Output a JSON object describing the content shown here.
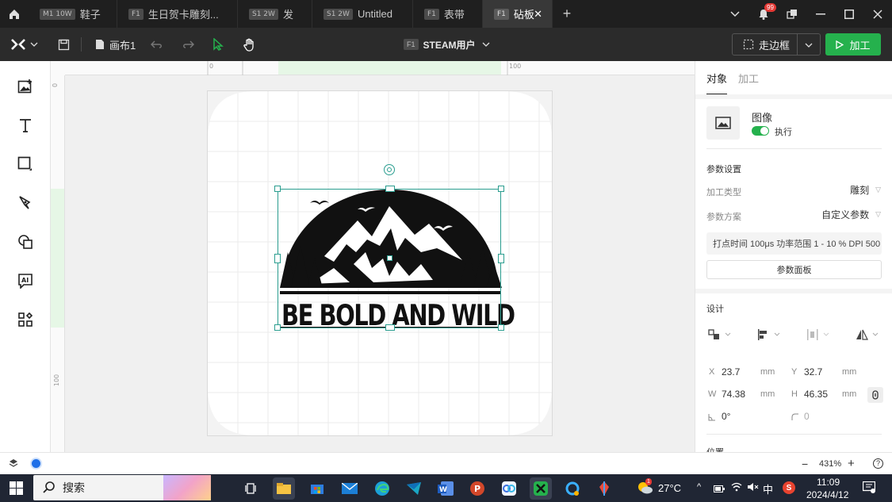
{
  "tabs": [
    {
      "badge": "M1 10W",
      "label": "鞋子"
    },
    {
      "badge": "F1",
      "label": "生日贺卡雕刻..."
    },
    {
      "badge": "S1 2W",
      "label": "发"
    },
    {
      "badge": "S1 2W",
      "label": "Untitled"
    },
    {
      "badge": "F1",
      "label": "表带"
    },
    {
      "badge": "F1",
      "label": "砧板"
    }
  ],
  "notification_count": "99",
  "toolbar": {
    "canvas_name": "画布1",
    "device_badge": "F1",
    "device_name": "STEAM用户",
    "bbox_label": "走边框",
    "process_label": "加工"
  },
  "ruler": {
    "top": [
      "0",
      "100"
    ],
    "left": [
      "0",
      "100"
    ]
  },
  "canvas": {
    "design_text": "BE BOLD AND WILD"
  },
  "panel": {
    "tabs": [
      "对象",
      "加工"
    ],
    "object_type": "图像",
    "execute_label": "执行",
    "params_title": "参数设置",
    "process_type_label": "加工类型",
    "process_type_value": "雕刻",
    "scheme_label": "参数方案",
    "scheme_value": "自定义参数",
    "param_summary": "打点时间 100μs 功率范围  1 - 10 % DPI 500",
    "param_panel_btn": "参数面板",
    "design_title": "设计",
    "x_label": "X",
    "x_value": "23.7",
    "y_label": "Y",
    "y_value": "32.7",
    "w_label": "W",
    "w_value": "74.38",
    "h_label": "H",
    "h_value": "46.35",
    "unit": "mm",
    "rotation_value": "0°",
    "corner_value": "0",
    "position_label": "位置"
  },
  "status": {
    "zoom": "431%"
  },
  "taskbar": {
    "search_label": "搜索",
    "weather_temp": "27°C",
    "weather_badge": "1",
    "ime_label": "中",
    "time": "11:09",
    "date": "2024/4/12"
  },
  "colors": {
    "accent_green": "#25b14d",
    "selection": "#2a9d8f",
    "titlebar": "#1f1f1f",
    "toolbar": "#2b2b2b"
  }
}
